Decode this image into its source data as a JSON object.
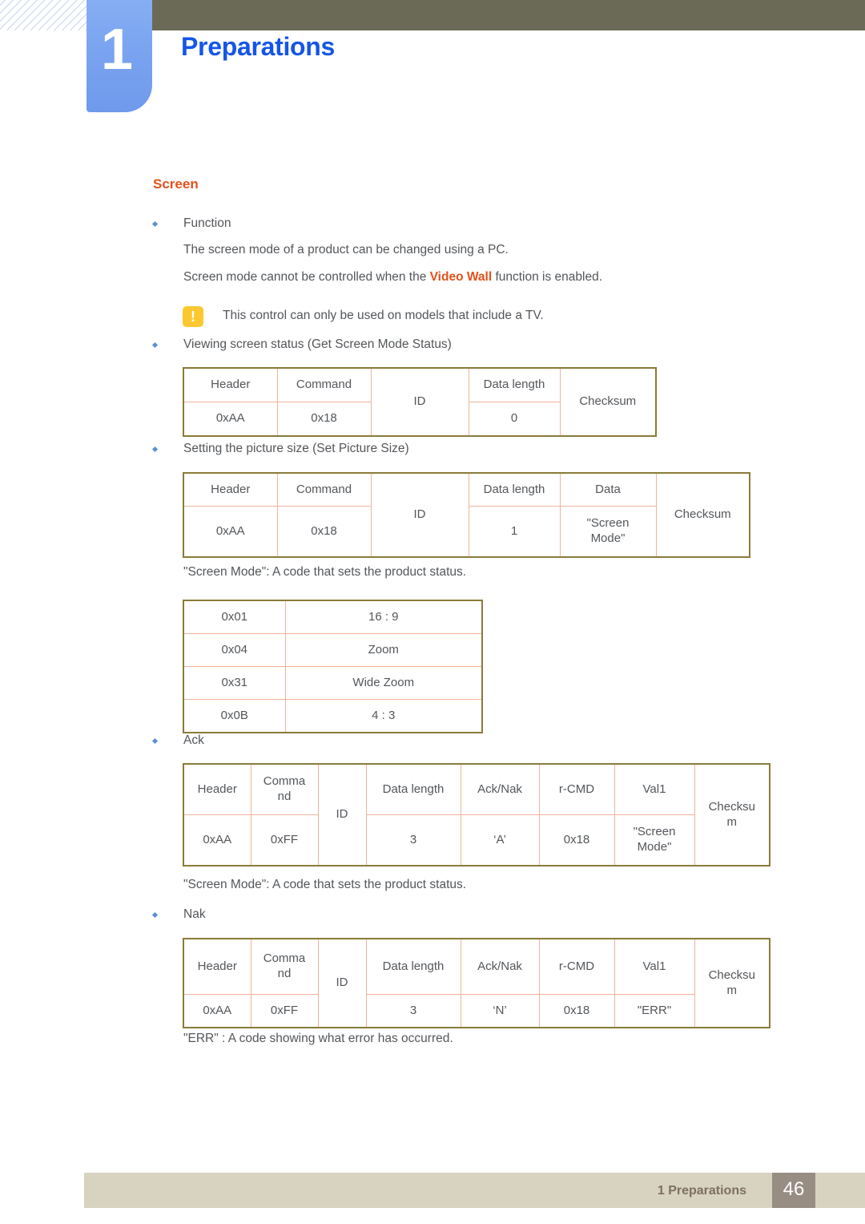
{
  "header": {
    "chapter_number": "1",
    "chapter_title": "Preparations"
  },
  "section": {
    "heading": "Screen"
  },
  "bullets": {
    "function": "Function",
    "viewing_status": "Viewing screen status (Get Screen Mode Status)",
    "setting_picture_size": "Setting the picture size (Set Picture Size)",
    "ack": "Ack",
    "nak": "Nak"
  },
  "paragraphs": {
    "screen_mode_pc": "The screen mode of a product can be changed using a PC.",
    "video_wall_pre": "Screen mode cannot be controlled when the ",
    "video_wall_highlight": "Video Wall",
    "video_wall_post": " function is enabled.",
    "note_tv": "This control can only be used on models that include a TV.",
    "screen_mode_code_1": "\"Screen Mode\": A code that sets the product status.",
    "screen_mode_code_2": "\"Screen Mode\": A code that sets the product status.",
    "err_code": "\"ERR\" : A code showing what error has occurred."
  },
  "note_icon": {
    "glyph": "!"
  },
  "tables": {
    "get_screen_mode_status": {
      "headers": [
        "Header",
        "Command",
        "ID",
        "Data length",
        "Checksum"
      ],
      "values": [
        "0xAA",
        "0x18",
        "0"
      ]
    },
    "set_picture_size": {
      "headers": [
        "Header",
        "Command",
        "ID",
        "Data length",
        "Data",
        "Checksum"
      ],
      "values": [
        "0xAA",
        "0x18",
        "1",
        "\"Screen Mode\""
      ]
    },
    "screen_mode_codes": {
      "rows": [
        {
          "code": "0x01",
          "mode": "16 : 9"
        },
        {
          "code": "0x04",
          "mode": "Zoom"
        },
        {
          "code": "0x31",
          "mode": "Wide Zoom"
        },
        {
          "code": "0x0B",
          "mode": "4 : 3"
        }
      ]
    },
    "ack": {
      "headers": [
        "Comma nd",
        "ID",
        "Data length",
        "Ack/Nak",
        "r-CMD",
        "Val1",
        "Checksu m"
      ],
      "header_first": "Header",
      "values": [
        "0xAA",
        "0xFF",
        "3",
        "‘A’",
        "0x18",
        "\"Screen Mode\""
      ]
    },
    "nak": {
      "headers": [
        "Comma nd",
        "ID",
        "Data length",
        "Ack/Nak",
        "r-CMD",
        "Val1",
        "Checksu m"
      ],
      "header_first": "Header",
      "values": [
        "0xAA",
        "0xFF",
        "3",
        "‘N’",
        "0x18",
        "\"ERR\""
      ]
    }
  },
  "footer": {
    "label": "1 Preparations",
    "page_number": "46"
  },
  "colors": {
    "accent_orange": "#e4521b",
    "title_blue": "#1555e8",
    "tab_blue": "#7ba5f0",
    "olive_bar": "#6b6a56",
    "table_outer_border": "#8a7b38",
    "table_inner_border": "#f0b49a",
    "footer_band": "#d8d2c0",
    "footer_pagebox": "#988d82",
    "note_yellow": "#fdc72f"
  }
}
